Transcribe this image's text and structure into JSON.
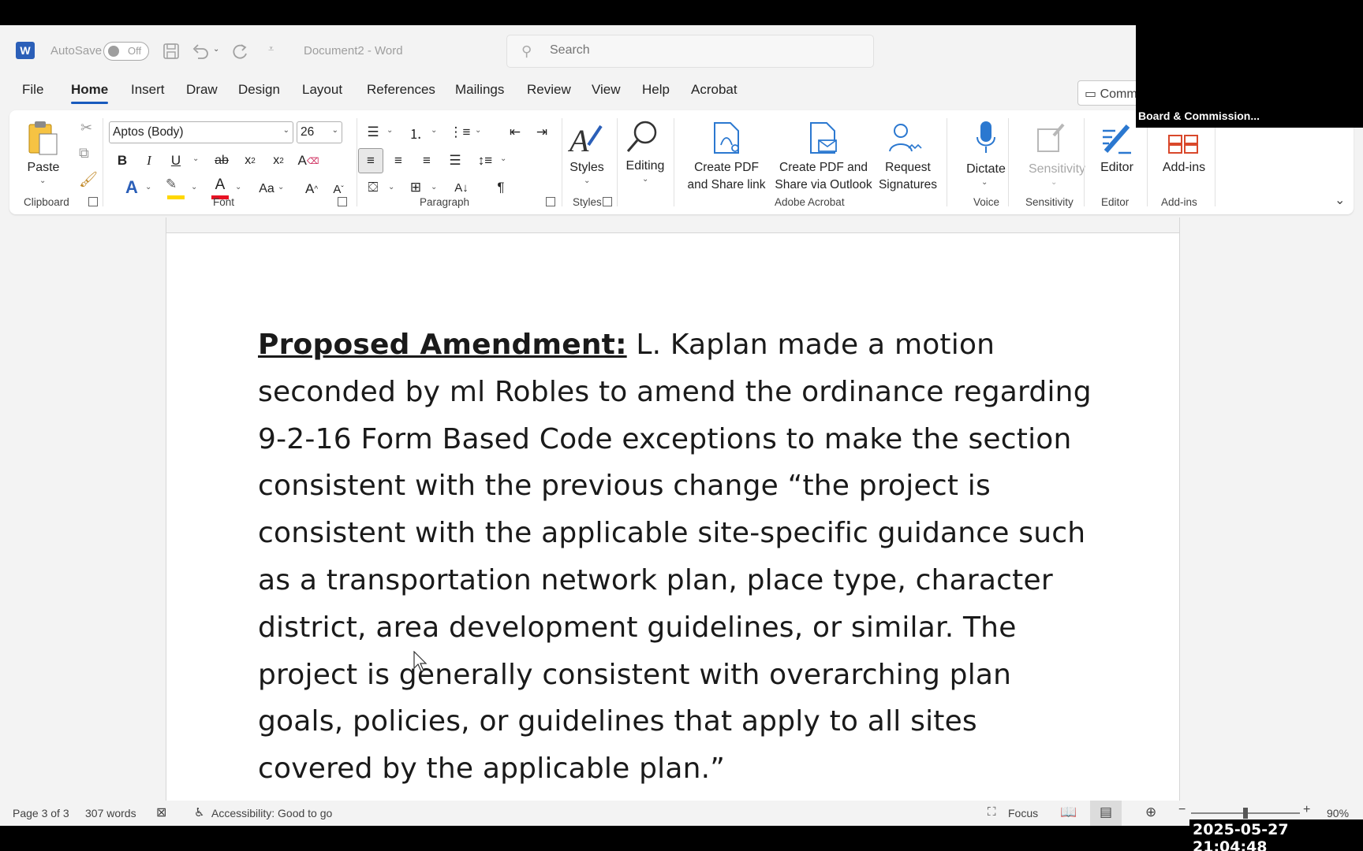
{
  "titlebar": {
    "autosave_label": "AutoSave",
    "autosave_state": "Off",
    "doc_title": "Document2  -  Word",
    "search_placeholder": "Search"
  },
  "tabs": [
    "File",
    "Home",
    "Insert",
    "Draw",
    "Design",
    "Layout",
    "References",
    "Mailings",
    "Review",
    "View",
    "Help",
    "Acrobat"
  ],
  "active_tab": "Home",
  "comments_label": "Comm",
  "ribbon": {
    "clipboard": {
      "paste": "Paste",
      "group": "Clipboard"
    },
    "font": {
      "font_name": "Aptos (Body)",
      "font_size": "26",
      "group": "Font"
    },
    "paragraph": {
      "group": "Paragraph"
    },
    "styles": {
      "styles": "Styles",
      "group": "Styles"
    },
    "editing": {
      "label": "Editing"
    },
    "acrobat": {
      "create_pdf_1": "Create PDF",
      "create_pdf_2": "and Share link",
      "create_pdf_outlook_1": "Create PDF and",
      "create_pdf_outlook_2": "Share via Outlook",
      "request_1": "Request",
      "request_2": "Signatures",
      "group": "Adobe Acrobat"
    },
    "voice": {
      "dictate": "Dictate",
      "group": "Voice"
    },
    "sensitivity": {
      "label": "Sensitivity",
      "group": "Sensitivity"
    },
    "editor": {
      "label": "Editor",
      "group": "Editor"
    },
    "addins": {
      "label": "Add-ins",
      "group": "Add-ins"
    }
  },
  "overlay_label": "Board & Commission...",
  "document": {
    "heading": "Proposed Amendment:",
    "body": " L. Kaplan made a motion seconded by ml Robles to amend the ordinance regarding 9-2-16 Form Based Code exceptions to make the section consistent with the previous change “the project is consistent with the applicable site-specific guidance such as a transportation network plan, place type, character district, area development guidelines, or similar. The project is generally consistent with overarching plan goals, policies, or guidelines that apply to all sites covered by the applicable plan.”"
  },
  "statusbar": {
    "page": "Page 3 of 3",
    "words": "307 words",
    "accessibility": "Accessibility: Good to go",
    "focus": "Focus",
    "zoom": "90%",
    "zoom_fraction": 0.5
  },
  "timestamp": "2025-05-27  21:04:48",
  "colors": {
    "accent": "#185abd",
    "word_blue": "#2b5fb8",
    "font_color_red": "#e81123",
    "highlight_yellow": "#ffd700"
  }
}
